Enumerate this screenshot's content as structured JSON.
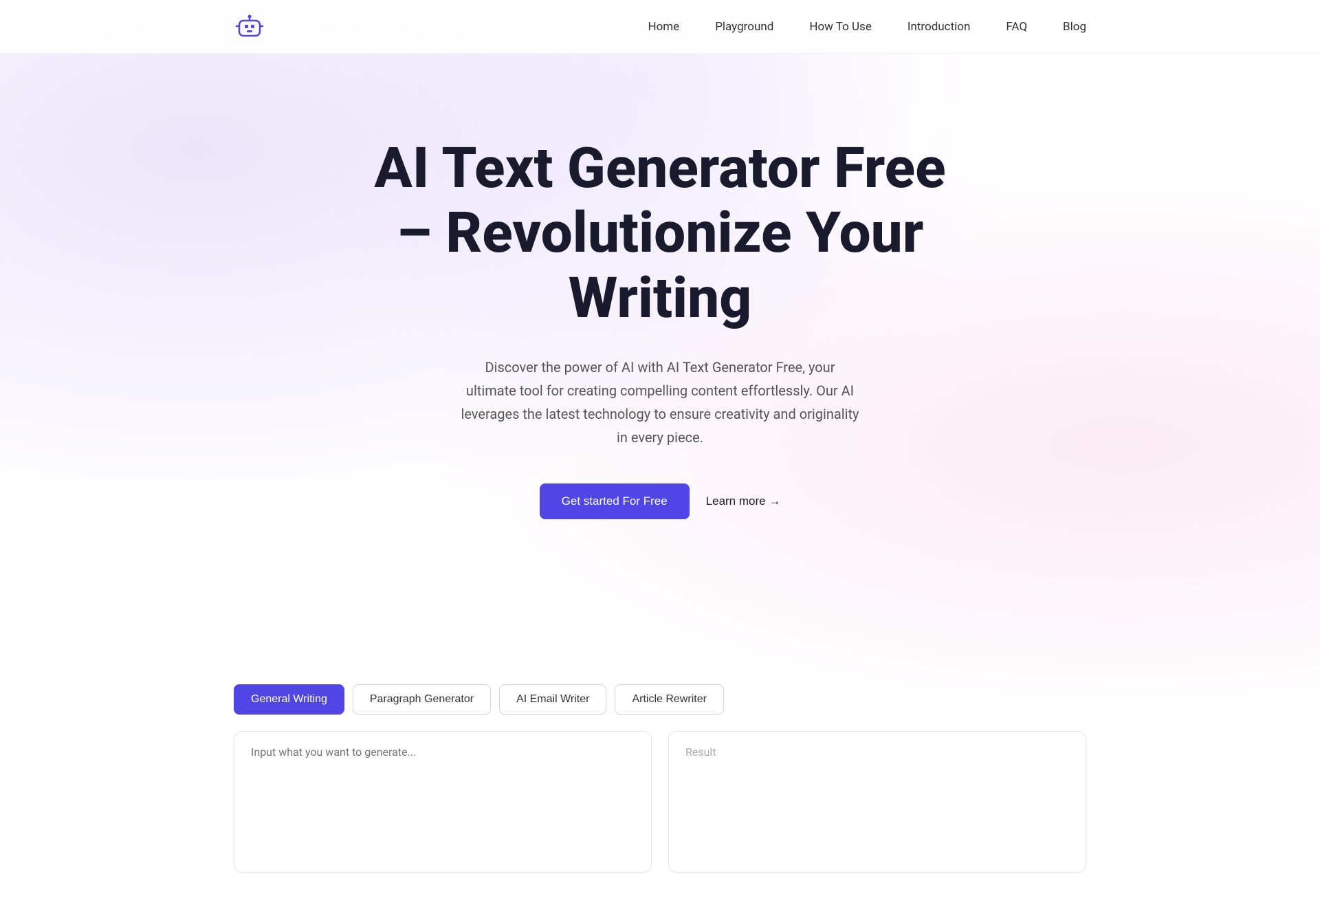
{
  "nav": {
    "links": [
      {
        "label": "Home",
        "id": "home"
      },
      {
        "label": "Playground",
        "id": "playground"
      },
      {
        "label": "How To Use",
        "id": "how-to-use"
      },
      {
        "label": "Introduction",
        "id": "introduction"
      },
      {
        "label": "FAQ",
        "id": "faq"
      },
      {
        "label": "Blog",
        "id": "blog"
      }
    ]
  },
  "hero": {
    "title": "AI Text Generator Free – Revolutionize Your Writing",
    "subtitle": "Discover the power of AI with AI Text Generator Free, your ultimate tool for creating compelling content effortlessly. Our AI leverages the latest technology to ensure creativity and originality in every piece.",
    "cta_primary": "Get started For Free",
    "cta_secondary": "Learn more →"
  },
  "playground": {
    "tabs": [
      {
        "label": "General Writing",
        "active": true
      },
      {
        "label": "Paragraph Generator",
        "active": false
      },
      {
        "label": "AI Email Writer",
        "active": false
      },
      {
        "label": "Article Rewriter",
        "active": false
      }
    ],
    "input_placeholder": "Input what you want to generate...",
    "result_label": "Result"
  },
  "colors": {
    "primary": "#5046e5",
    "text_dark": "#1a1a2e",
    "text_muted": "#555"
  }
}
